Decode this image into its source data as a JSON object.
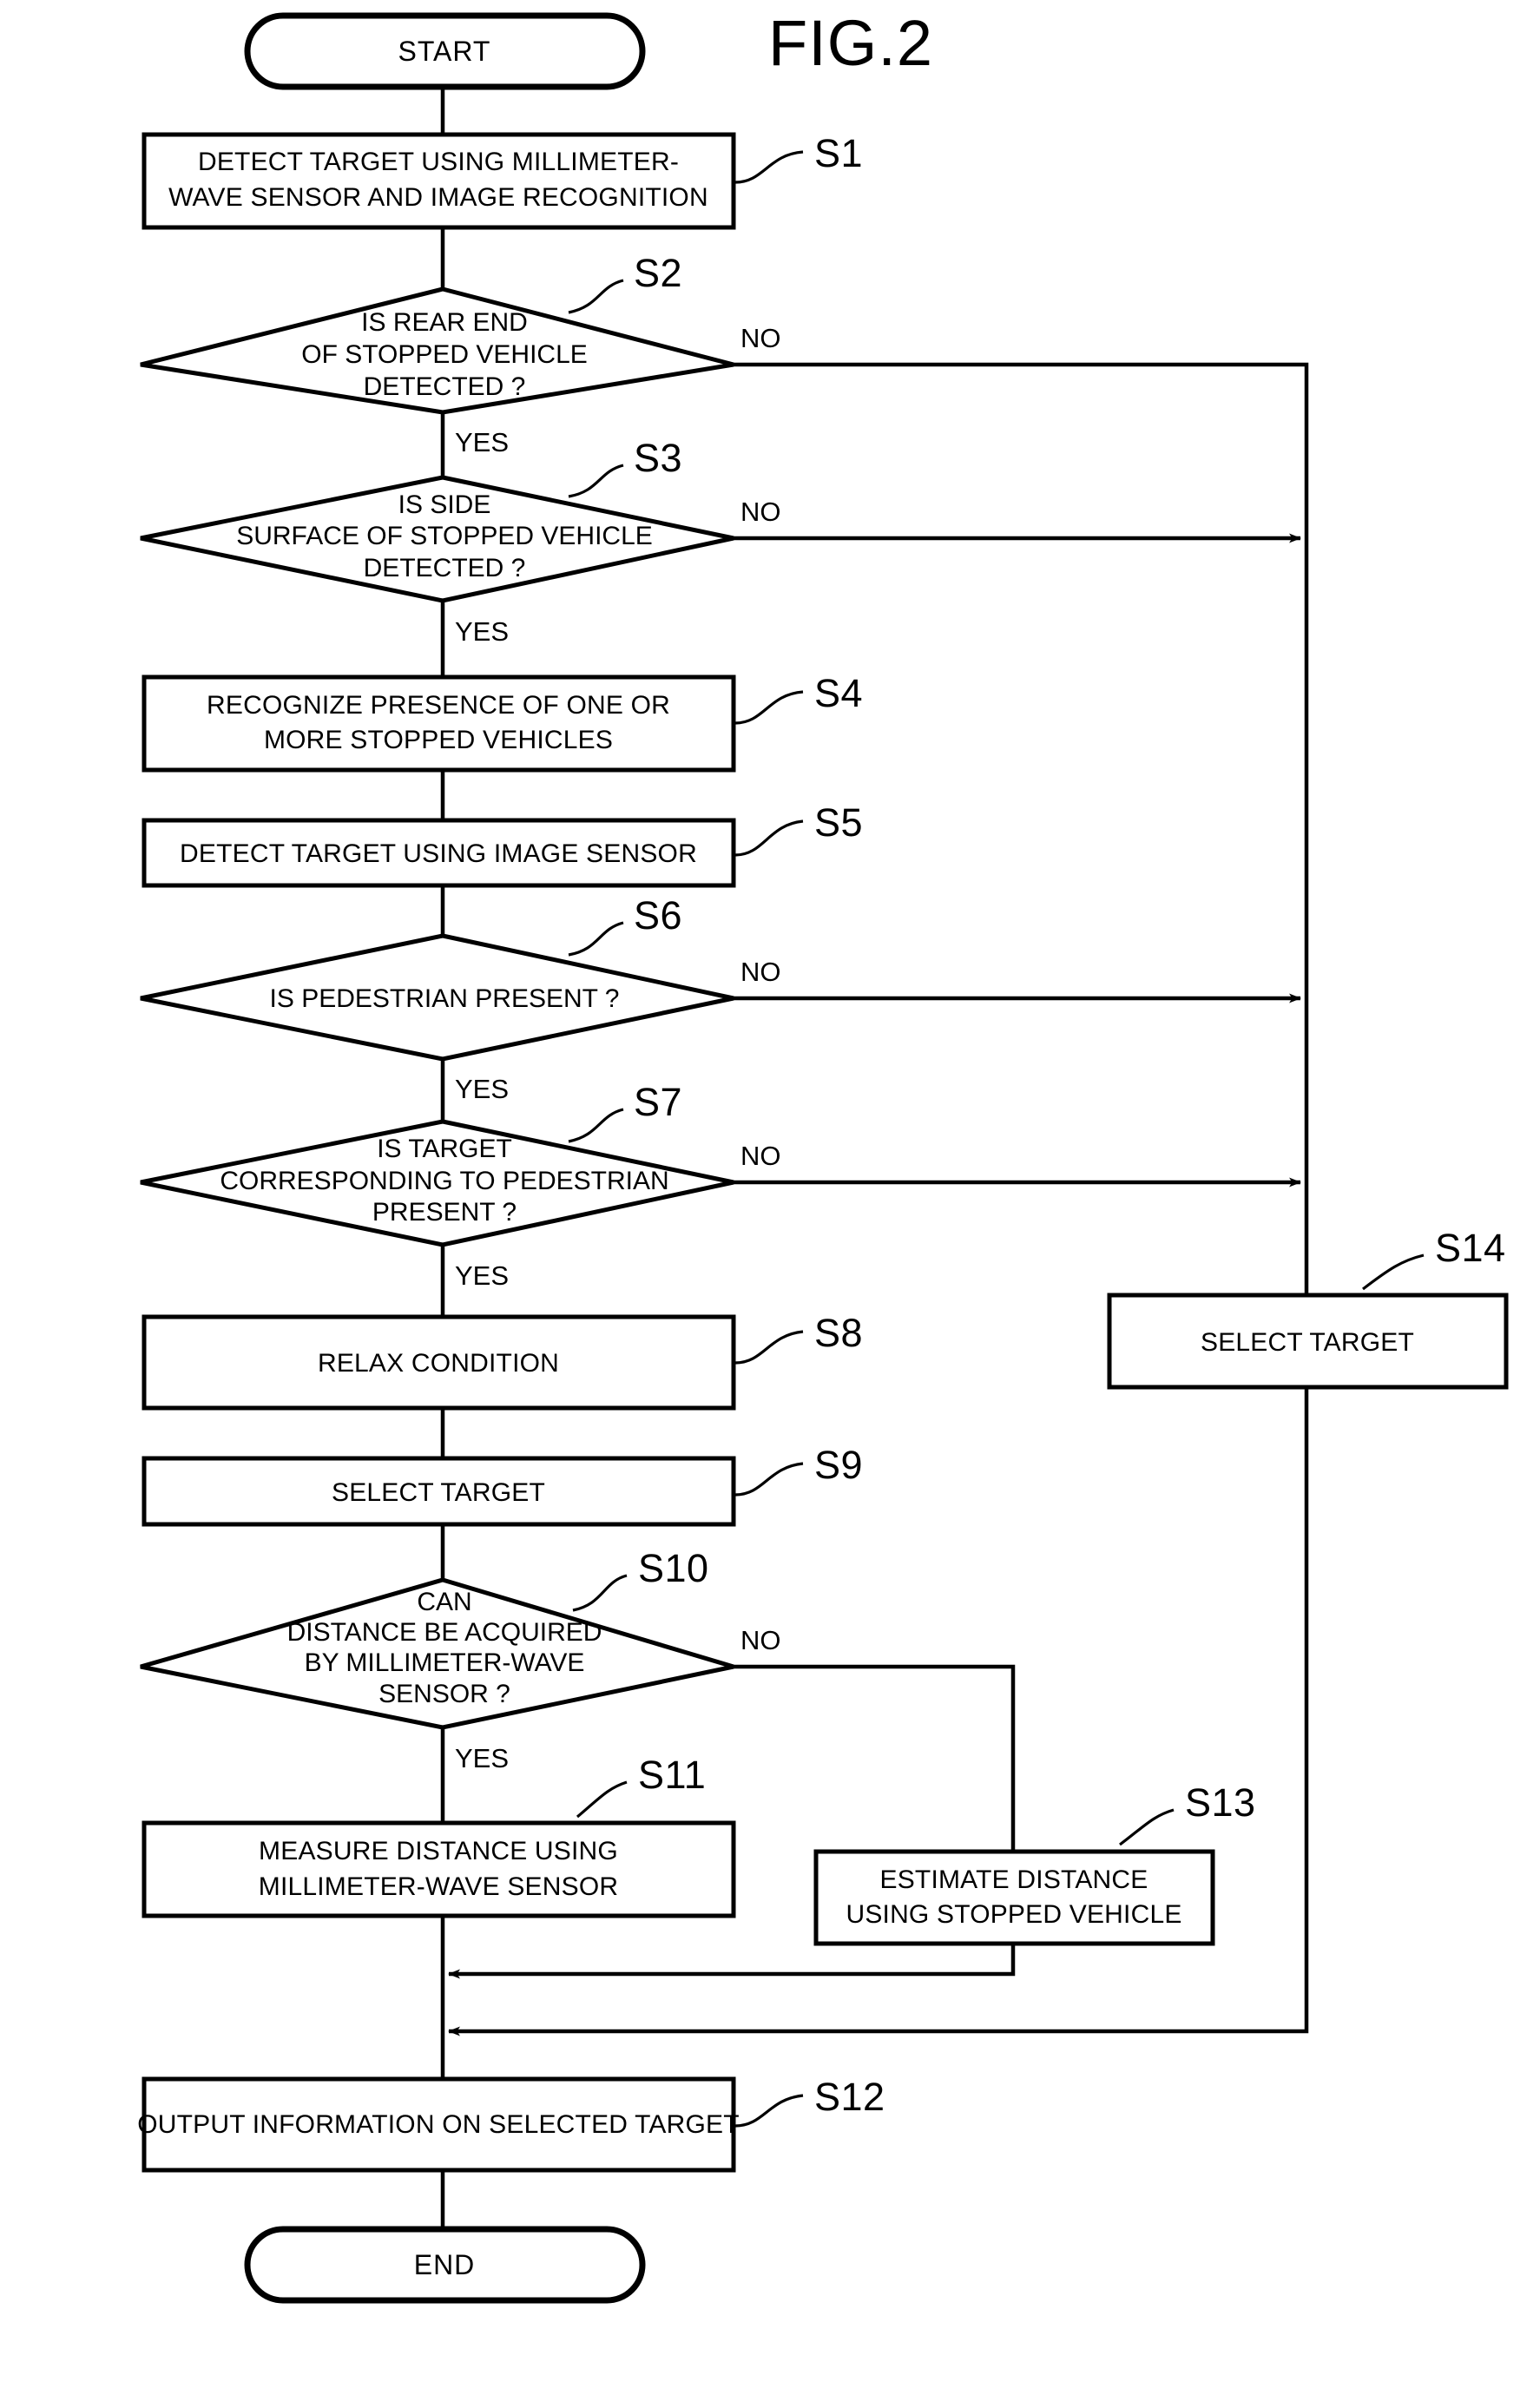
{
  "figure": {
    "title": "FIG.2",
    "type": "flowchart"
  },
  "labels": {
    "yes": "YES",
    "no": "NO"
  },
  "terminators": {
    "start": "START",
    "end": "END"
  },
  "nodes": [
    {
      "id": "S1",
      "step": "S1",
      "shape": "process",
      "lines": [
        "DETECT TARGET USING MILLIMETER-",
        "WAVE SENSOR AND IMAGE RECOGNITION"
      ]
    },
    {
      "id": "S2",
      "step": "S2",
      "shape": "decision",
      "lines": [
        "IS REAR END",
        "OF STOPPED VEHICLE",
        "DETECTED ?"
      ],
      "yes": "YES",
      "no": "NO"
    },
    {
      "id": "S3",
      "step": "S3",
      "shape": "decision",
      "lines": [
        "IS SIDE",
        "SURFACE OF STOPPED VEHICLE",
        "DETECTED ?"
      ],
      "yes": "YES",
      "no": "NO"
    },
    {
      "id": "S4",
      "step": "S4",
      "shape": "process",
      "lines": [
        "RECOGNIZE PRESENCE OF ONE OR",
        "MORE STOPPED VEHICLES"
      ]
    },
    {
      "id": "S5",
      "step": "S5",
      "shape": "process",
      "lines": [
        "DETECT TARGET USING IMAGE SENSOR"
      ]
    },
    {
      "id": "S6",
      "step": "S6",
      "shape": "decision",
      "lines": [
        "IS PEDESTRIAN PRESENT ?"
      ],
      "yes": "YES",
      "no": "NO"
    },
    {
      "id": "S7",
      "step": "S7",
      "shape": "decision",
      "lines": [
        "IS TARGET",
        "CORRESPONDING TO PEDESTRIAN",
        "PRESENT ?"
      ],
      "yes": "YES",
      "no": "NO"
    },
    {
      "id": "S8",
      "step": "S8",
      "shape": "process",
      "lines": [
        "RELAX CONDITION"
      ]
    },
    {
      "id": "S9",
      "step": "S9",
      "shape": "process",
      "lines": [
        "SELECT TARGET"
      ]
    },
    {
      "id": "S10",
      "step": "S10",
      "shape": "decision",
      "lines": [
        "CAN",
        "DISTANCE BE ACQUIRED",
        "BY MILLIMETER-WAVE",
        "SENSOR ?"
      ],
      "yes": "YES",
      "no": "NO"
    },
    {
      "id": "S11",
      "step": "S11",
      "shape": "process",
      "lines": [
        "MEASURE DISTANCE USING",
        "MILLIMETER-WAVE SENSOR"
      ]
    },
    {
      "id": "S12",
      "step": "S12",
      "shape": "process",
      "lines": [
        "OUTPUT INFORMATION ON SELECTED TARGET"
      ]
    },
    {
      "id": "S13",
      "step": "S13",
      "shape": "process",
      "lines": [
        "ESTIMATE DISTANCE",
        "USING STOPPED VEHICLE"
      ]
    },
    {
      "id": "S14",
      "step": "S14",
      "shape": "process",
      "lines": [
        "SELECT TARGET"
      ]
    }
  ],
  "chart_data": {
    "type": "flowchart",
    "title": "FIG.2",
    "colors": {
      "line": "#000000",
      "fill": "#ffffff",
      "text": "#000000"
    }
  }
}
